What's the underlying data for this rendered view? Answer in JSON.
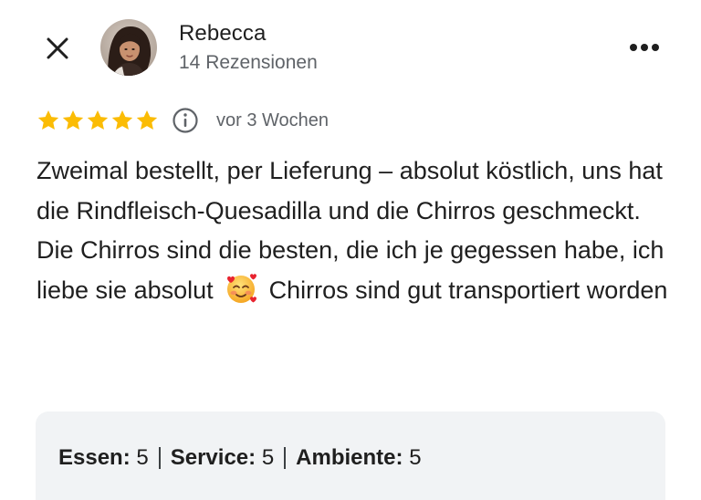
{
  "header": {
    "close_icon": "close-icon",
    "more_icon": "more-options-icon",
    "user_name": "Rebecca",
    "review_count": "14 Rezensionen"
  },
  "review": {
    "rating": 5,
    "rating_max": 5,
    "info_icon": "info-icon",
    "date": "vor 3 Wochen",
    "text_before_emoji": "Zweimal bestellt, per Lieferung – absolut köstlich, uns hat die Rindfleisch-Quesadilla und die Chirros geschmeckt. Die Chirros sind die besten, die ich je gegessen habe, ich liebe sie absolut",
    "emoji": "smiling-face-with-hearts",
    "text_after_emoji": "Chirros sind gut transportiert worden"
  },
  "sub_ratings": [
    {
      "label": "Essen:",
      "value": "5"
    },
    {
      "label": "Service:",
      "value": "5"
    },
    {
      "label": "Ambiente:",
      "value": "5"
    }
  ],
  "colors": {
    "star": "#fbbc04",
    "text": "#1f1f1f",
    "secondary_text": "#5f6368",
    "ratings_box_bg": "#f1f3f5"
  }
}
